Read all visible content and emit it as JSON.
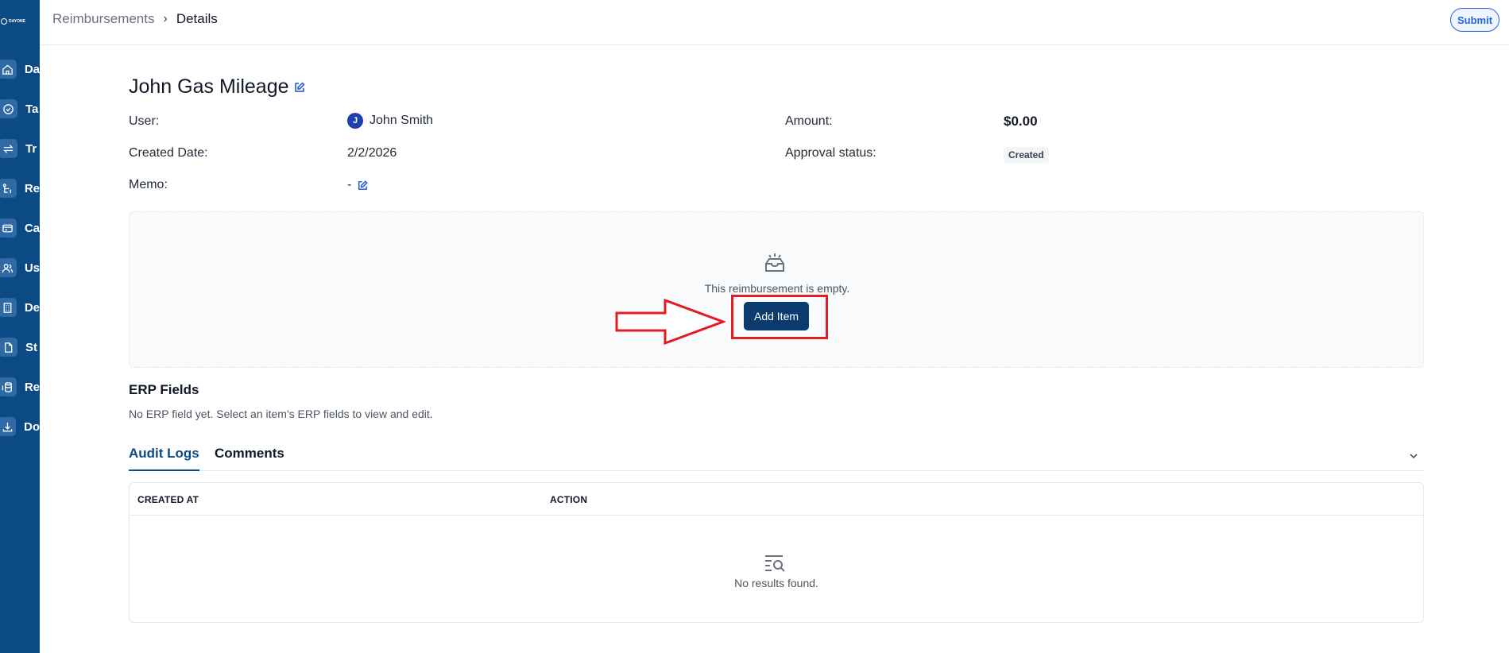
{
  "sidebar": {
    "logo_text": "DAYONE",
    "items": [
      {
        "label": "Da",
        "icon": "home-icon"
      },
      {
        "label": "Ta",
        "icon": "task-check-icon"
      },
      {
        "label": "Tr",
        "icon": "transfer-icon"
      },
      {
        "label": "Re",
        "icon": "reimbursement-icon"
      },
      {
        "label": "Ca",
        "icon": "card-icon"
      },
      {
        "label": "Us",
        "icon": "users-icon"
      },
      {
        "label": "De",
        "icon": "building-icon"
      },
      {
        "label": "St",
        "icon": "document-icon"
      },
      {
        "label": "Re",
        "icon": "database-icon"
      },
      {
        "label": "Do",
        "icon": "download-icon"
      }
    ]
  },
  "header": {
    "breadcrumb_root": "Reimbursements",
    "breadcrumb_sep": "›",
    "breadcrumb_current": "Details",
    "submit_label": "Submit"
  },
  "details": {
    "title": "John Gas Mileage",
    "user_label": "User:",
    "user_initial": "J",
    "user_name": "John Smith",
    "created_label": "Created Date:",
    "created_value": "2/2/2026",
    "memo_label": "Memo:",
    "memo_value": "-",
    "amount_label": "Amount:",
    "amount_value": "$0.00",
    "approval_label": "Approval status:",
    "approval_value": "Created"
  },
  "empty_state": {
    "text": "This reimbursement is empty.",
    "add_label": "Add Item"
  },
  "erp": {
    "title": "ERP Fields",
    "description": "No ERP field yet. Select an item's ERP fields to view and edit."
  },
  "tabs": [
    "Audit Logs",
    "Comments"
  ],
  "audit_table": {
    "columns": [
      "CREATED AT",
      "ACTION"
    ],
    "empty_text": "No results found."
  },
  "colors": {
    "sidebar": "#0b4a84",
    "primary_button": "#0b3a6e",
    "annotation_red": "#e31b23",
    "submit_blue": "#2563eb"
  }
}
